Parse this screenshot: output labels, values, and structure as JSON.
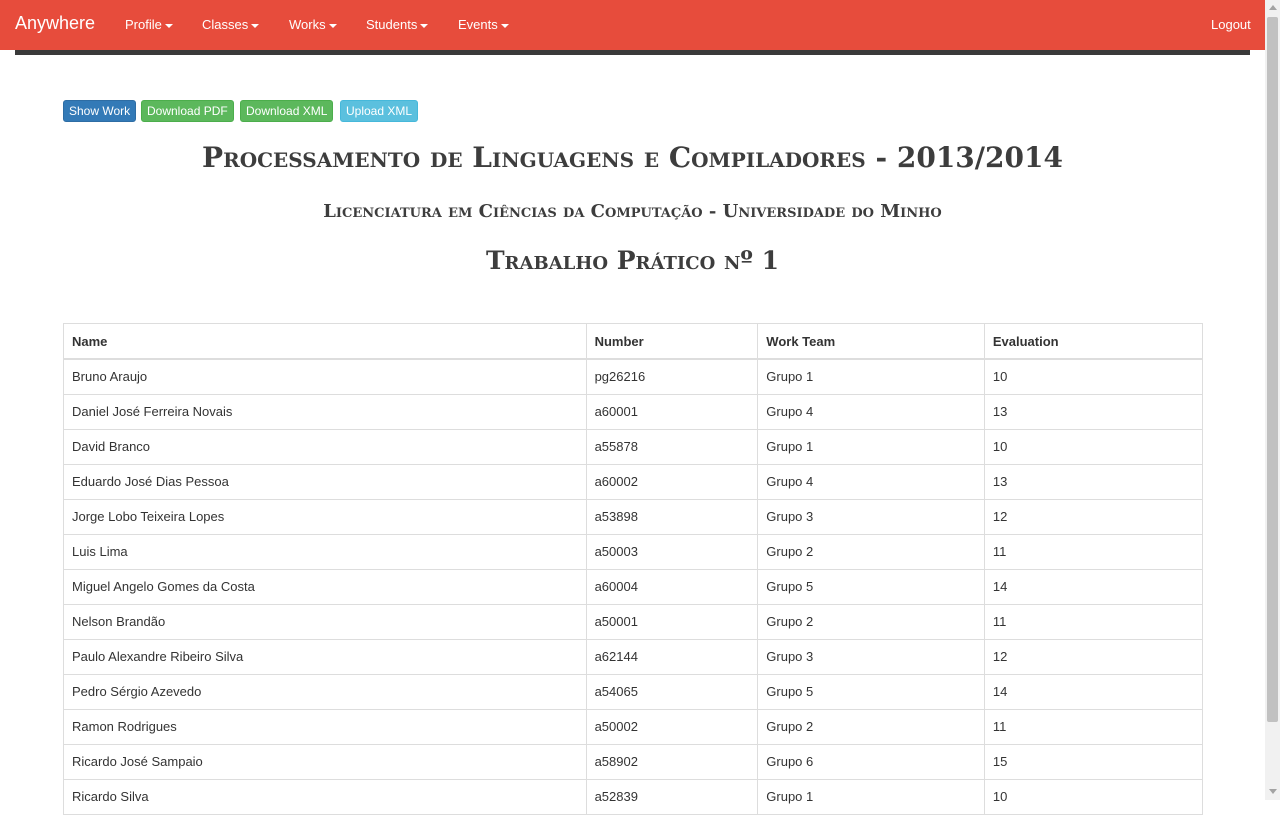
{
  "navbar": {
    "brand": "Anywhere",
    "items": [
      {
        "label": "Profile"
      },
      {
        "label": "Classes"
      },
      {
        "label": "Works"
      },
      {
        "label": "Students"
      },
      {
        "label": "Events"
      }
    ],
    "logout": "Logout"
  },
  "actions": {
    "show_work": "Show Work",
    "download_pdf": "Download PDF",
    "download_xml": "Download XML",
    "upload_xml": "Upload XML"
  },
  "headings": {
    "course": "Processamento de Linguagens e Compiladores - 2013/2014",
    "degree": "Licenciatura em Ciências da Computação - Universidade do Minho",
    "assignment": "Trabalho Prático nº 1"
  },
  "table": {
    "columns": [
      "Name",
      "Number",
      "Work Team",
      "Evaluation"
    ],
    "rows": [
      [
        "Bruno Araujo",
        "pg26216",
        "Grupo 1",
        "10"
      ],
      [
        "Daniel José Ferreira Novais",
        "a60001",
        "Grupo 4",
        "13"
      ],
      [
        "David Branco",
        "a55878",
        "Grupo 1",
        "10"
      ],
      [
        "Eduardo José Dias Pessoa",
        "a60002",
        "Grupo 4",
        "13"
      ],
      [
        "Jorge Lobo Teixeira Lopes",
        "a53898",
        "Grupo 3",
        "12"
      ],
      [
        "Luis Lima",
        "a50003",
        "Grupo 2",
        "11"
      ],
      [
        "Miguel Angelo Gomes da Costa",
        "a60004",
        "Grupo 5",
        "14"
      ],
      [
        "Nelson Brandão",
        "a50001",
        "Grupo 2",
        "11"
      ],
      [
        "Paulo Alexandre Ribeiro Silva",
        "a62144",
        "Grupo 3",
        "12"
      ],
      [
        "Pedro Sérgio Azevedo",
        "a54065",
        "Grupo 5",
        "14"
      ],
      [
        "Ramon Rodrigues",
        "a50002",
        "Grupo 2",
        "11"
      ],
      [
        "Ricardo José Sampaio",
        "a58902",
        "Grupo 6",
        "15"
      ],
      [
        "Ricardo Silva",
        "a52839",
        "Grupo 1",
        "10"
      ]
    ]
  },
  "colors": {
    "navbar": "#e74c3c",
    "primary": "#337ab7",
    "success": "#5cb85c",
    "info": "#5bc0de"
  }
}
